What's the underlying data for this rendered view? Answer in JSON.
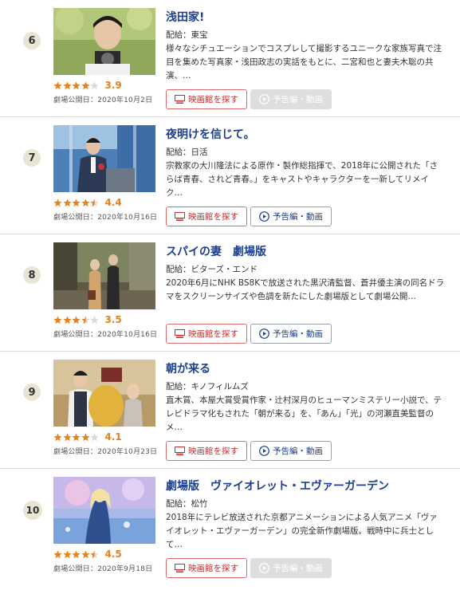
{
  "buttons": {
    "theater_label": "映画館を探す",
    "trailer_label": "予告編・動画"
  },
  "items": [
    {
      "rank": "6",
      "title": "浅田家!",
      "distributor": "配給：東宝",
      "description": "様々なシチュエーションでコスプレして撮影するユニークな家族写真で注目を集めた写真家・浅田政志の実話をもとに、二宮和也と妻夫木聡の共演、…",
      "rating": 3.9,
      "score": "3.9",
      "date": "劇場公開日：2020年10月2日",
      "trailer_available": false
    },
    {
      "rank": "7",
      "title": "夜明けを信じて。",
      "distributor": "配給：日活",
      "description": "宗教家の大川隆法による原作・製作総指揮で、2018年に公開された「さらば青春、されど青春。」をキャストやキャラクターを一新してリメイク…",
      "rating": 4.4,
      "score": "4.4",
      "date": "劇場公開日：2020年10月16日",
      "trailer_available": true
    },
    {
      "rank": "8",
      "title": "スパイの妻　劇場版",
      "distributor": "配給：ビターズ・エンド",
      "description": "2020年6月にNHK BS8Kで放送された黒沢清監督、蒼井優主演の同名ドラマをスクリーンサイズや色調を新たにした劇場版として劇場公開…",
      "rating": 3.5,
      "score": "3.5",
      "date": "劇場公開日：2020年10月16日",
      "trailer_available": true
    },
    {
      "rank": "9",
      "title": "朝が来る",
      "distributor": "配給：キノフィルムズ",
      "description": "直木賞、本屋大賞受賞作家・辻村深月のヒューマンミステリー小説で、テレビドラマ化もされた「朝が来る」を、「あん」「光」の河瀬直美監督のメ…",
      "rating": 4.1,
      "score": "4.1",
      "date": "劇場公開日：2020年10月23日",
      "trailer_available": true
    },
    {
      "rank": "10",
      "title": "劇場版　ヴァイオレット・エヴァーガーデン",
      "distributor": "配給：松竹",
      "description": "2018年にテレビ放送された京都アニメーションによる人気アニメ「ヴァイオレット・エヴァーガーデン」の完全新作劇場版。戦時中に兵士として…",
      "rating": 4.5,
      "score": "4.5",
      "date": "劇場公開日：2020年9月18日",
      "trailer_available": false
    }
  ],
  "colors": {
    "title": "#1c3f8e",
    "star": "#e6821e",
    "theater_button": "#c62f2f",
    "rank_badge": "#e9e5d4",
    "disabled_button": "#dedede"
  },
  "icons": {
    "theater": "theater-screen-icon",
    "trailer": "play-circle-icon",
    "star": "star-icon"
  }
}
